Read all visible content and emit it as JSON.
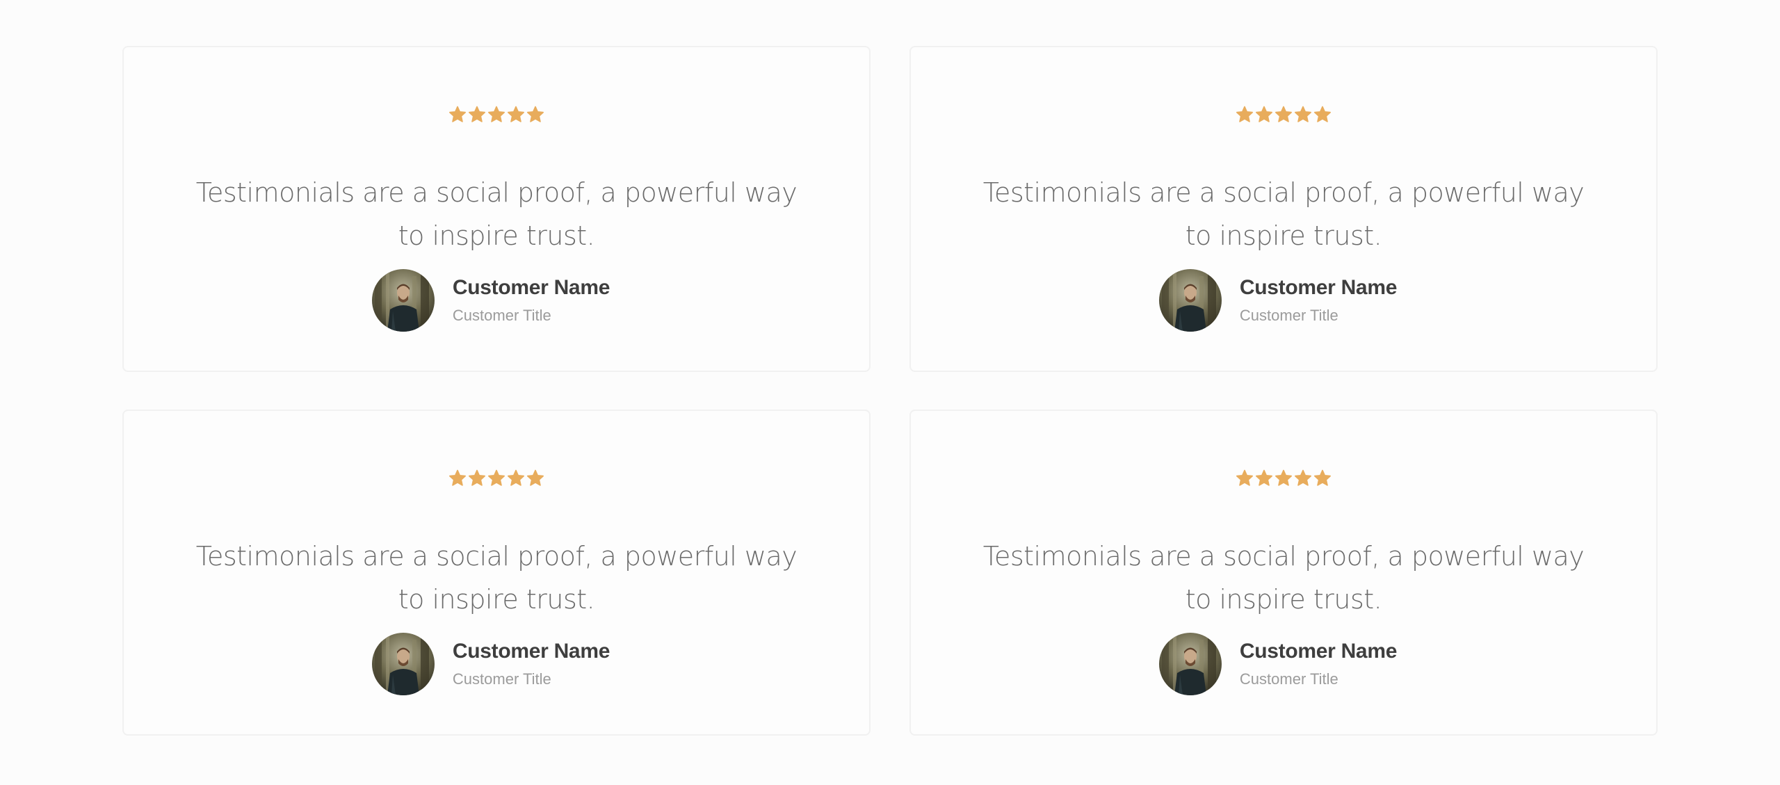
{
  "colors": {
    "star": "#e8ac5c",
    "quote_text": "#6a6a6a",
    "name_text": "#3e3e3e",
    "title_text": "#9b9b9b",
    "card_border": "#f1f1f1"
  },
  "testimonials": [
    {
      "rating": 5,
      "star_icon": "star-icon",
      "quote": "Testimonials are a social proof, a powerful way to inspire trust.",
      "name": "Customer Name",
      "title": "Customer Title"
    },
    {
      "rating": 5,
      "star_icon": "star-icon",
      "quote": "Testimonials are a social proof, a powerful way to inspire trust.",
      "name": "Customer Name",
      "title": "Customer Title"
    },
    {
      "rating": 5,
      "star_icon": "star-icon",
      "quote": "Testimonials are a social proof, a powerful way to inspire trust.",
      "name": "Customer Name",
      "title": "Customer Title"
    },
    {
      "rating": 5,
      "star_icon": "star-icon",
      "quote": "Testimonials are a social proof, a powerful way to inspire trust.",
      "name": "Customer Name",
      "title": "Customer Title"
    }
  ]
}
